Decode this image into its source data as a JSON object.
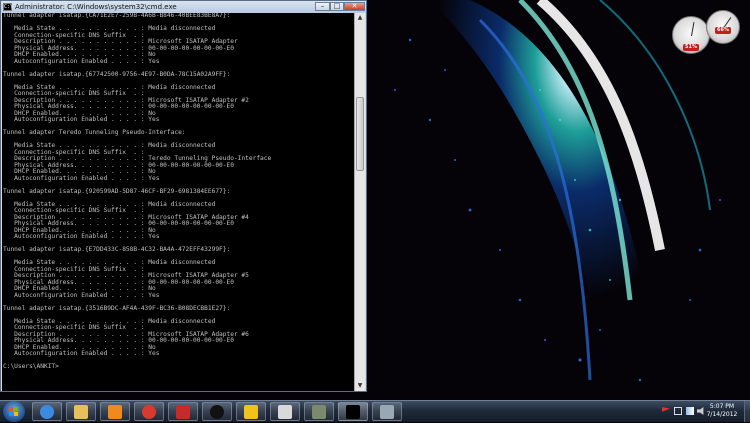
{
  "cmd": {
    "title": "Administrator: C:\\Windows\\system32\\cmd.exe",
    "icon_text": "C:\\",
    "minimize": "–",
    "maximize": "□",
    "close": "✕",
    "lines": [
      "Tunnel adapter isatap.{CA71E2E7-259B-4A6B-B846-40BEE83BE8A7}:",
      "",
      "   Media State . . . . . . . . . . . : Media disconnected",
      "   Connection-specific DNS Suffix  . :",
      "   Description . . . . . . . . . . . : Microsoft ISATAP Adapter",
      "   Physical Address. . . . . . . . . : 00-00-00-00-00-00-00-E0",
      "   DHCP Enabled. . . . . . . . . . . : No",
      "   Autoconfiguration Enabled . . . . : Yes",
      "",
      "Tunnel adapter isatap.{67742500-9756-4E97-B0DA-78C15A02A9FF}:",
      "",
      "   Media State . . . . . . . . . . . : Media disconnected",
      "   Connection-specific DNS Suffix  . :",
      "   Description . . . . . . . . . . . : Microsoft ISATAP Adapter #2",
      "   Physical Address. . . . . . . . . : 00-00-00-00-00-00-00-E0",
      "   DHCP Enabled. . . . . . . . . . . : No",
      "   Autoconfiguration Enabled . . . . : Yes",
      "",
      "Tunnel adapter Teredo Tunneling Pseudo-Interface:",
      "",
      "   Media State . . . . . . . . . . . : Media disconnected",
      "   Connection-specific DNS Suffix  . :",
      "   Description . . . . . . . . . . . : Teredo Tunneling Pseudo-Interface",
      "   Physical Address. . . . . . . . . : 00-00-00-00-00-00-00-E0",
      "   DHCP Enabled. . . . . . . . . . . : No",
      "   Autoconfiguration Enabled . . . . : Yes",
      "",
      "Tunnel adapter isatap.{920599AD-5D87-46CF-BF29-6981384EE677}:",
      "",
      "   Media State . . . . . . . . . . . : Media disconnected",
      "   Connection-specific DNS Suffix  . :",
      "   Description . . . . . . . . . . . : Microsoft ISATAP Adapter #4",
      "   Physical Address. . . . . . . . . : 00-00-00-00-00-00-00-E0",
      "   DHCP Enabled. . . . . . . . . . . : No",
      "   Autoconfiguration Enabled . . . . : Yes",
      "",
      "Tunnel adapter isatap.{E7DD433C-858B-4C32-BA4A-472EFF43299F}:",
      "",
      "   Media State . . . . . . . . . . . : Media disconnected",
      "   Connection-specific DNS Suffix  . :",
      "   Description . . . . . . . . . . . : Microsoft ISATAP Adapter #5",
      "   Physical Address. . . . . . . . . : 00-00-00-00-00-00-00-E0",
      "   DHCP Enabled. . . . . . . . . . . : No",
      "   Autoconfiguration Enabled . . . . : Yes",
      "",
      "Tunnel adapter isatap.{3516B9DC-AF4A-439F-BC36-B08DECBB1E27}:",
      "",
      "   Media State . . . . . . . . . . . : Media disconnected",
      "   Connection-specific DNS Suffix  . :",
      "   Description . . . . . . . . . . . : Microsoft ISATAP Adapter #6",
      "   Physical Address. . . . . . . . . : 00-00-00-00-00-00-00-E0",
      "   DHCP Enabled. . . . . . . . . . . : No",
      "   Autoconfiguration Enabled . . . . : Yes",
      "",
      "C:\\Users\\ANKIT>"
    ]
  },
  "gadgets": {
    "cpu_percent": "51%",
    "memory_percent": "66%"
  },
  "taskbar": {
    "items": [
      {
        "name": "internet-explorer-icon",
        "color": "#3c8be0"
      },
      {
        "name": "windows-explorer-icon",
        "color": "#e6c15a"
      },
      {
        "name": "media-player-icon",
        "color": "#f08a1c"
      },
      {
        "name": "chrome-icon",
        "color": "#d83a2e"
      },
      {
        "name": "filezilla-icon",
        "color": "#c52b2b"
      },
      {
        "name": "steam-icon",
        "color": "#111111"
      },
      {
        "name": "arrow-app-icon",
        "color": "#f0c21c"
      },
      {
        "name": "notepad-icon",
        "color": "#d9d9d9"
      },
      {
        "name": "m-app-icon",
        "color": "#7a8a6a"
      },
      {
        "name": "cmd-icon",
        "color": "#000000"
      },
      {
        "name": "network-app-icon",
        "color": "#9aa7b5"
      }
    ],
    "clock_time": "5:07 PM",
    "clock_date": "7/14/2012",
    "accent": "#1f2a3b"
  }
}
